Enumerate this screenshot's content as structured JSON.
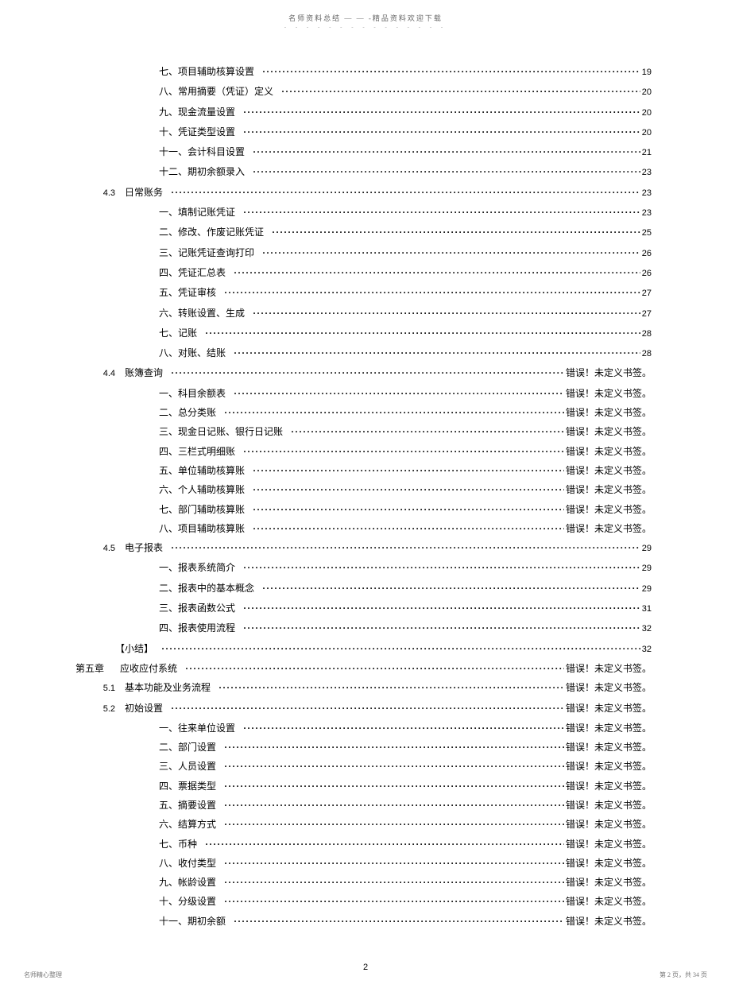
{
  "header": "名师资料总结 — — -精品资料欢迎下载",
  "header_sub": "- - - - - - - - - - - - - - -",
  "error_text": "错误！未定义书签。",
  "toc": [
    {
      "type": "sub",
      "title": "七、项目辅助核算设置",
      "page": "19"
    },
    {
      "type": "sub",
      "title": "八、常用摘要（凭证）定义",
      "page": "20"
    },
    {
      "type": "sub",
      "title": "九、现金流量设置",
      "page": "20"
    },
    {
      "type": "sub",
      "title": "十、凭证类型设置",
      "page": "20"
    },
    {
      "type": "sub",
      "title": "十一、会计科目设置",
      "page": "21"
    },
    {
      "type": "sub",
      "title": "十二、期初余额录入",
      "page": "23"
    },
    {
      "type": "sec",
      "num": "4.3",
      "title": "日常账务",
      "page": "23"
    },
    {
      "type": "sub",
      "title": "一、填制记账凭证",
      "page": "23"
    },
    {
      "type": "sub",
      "title": "二、修改、作废记账凭证",
      "page": "25"
    },
    {
      "type": "sub",
      "title": "三、记账凭证查询打印",
      "page": "26"
    },
    {
      "type": "sub",
      "title": "四、凭证汇总表",
      "page": "26"
    },
    {
      "type": "sub",
      "title": "五、凭证审核",
      "page": "27"
    },
    {
      "type": "sub",
      "title": "六、转账设置、生成",
      "page": "27"
    },
    {
      "type": "sub",
      "title": "七、记账",
      "page": "28"
    },
    {
      "type": "sub",
      "title": "八、对账、结账",
      "page": "28"
    },
    {
      "type": "sec",
      "num": "4.4",
      "title": "账簿查询",
      "page": "err"
    },
    {
      "type": "sub",
      "title": "一、科目余额表",
      "page": "err"
    },
    {
      "type": "sub",
      "title": "二、总分类账",
      "page": "err"
    },
    {
      "type": "sub",
      "title": "三、现金日记账、银行日记账",
      "page": "err"
    },
    {
      "type": "sub",
      "title": "四、三栏式明细账",
      "page": "err"
    },
    {
      "type": "sub",
      "title": "五、单位辅助核算账",
      "page": "err"
    },
    {
      "type": "sub",
      "title": "六、个人辅助核算账",
      "page": "err"
    },
    {
      "type": "sub",
      "title": "七、部门辅助核算账",
      "page": "err"
    },
    {
      "type": "sub",
      "title": "八、项目辅助核算账",
      "page": "err"
    },
    {
      "type": "sec",
      "num": "4.5",
      "title": "电子报表",
      "page": "29"
    },
    {
      "type": "sub",
      "title": "一、报表系统简介",
      "page": "29"
    },
    {
      "type": "sub",
      "title": "二、报表中的基本概念",
      "page": "29"
    },
    {
      "type": "sub",
      "title": "三、报表函数公式",
      "page": "31"
    },
    {
      "type": "sub",
      "title": "四、报表使用流程",
      "page": "32"
    },
    {
      "type": "summary",
      "title": "【小结】",
      "page": "32"
    },
    {
      "type": "chapter",
      "chapter": "第五章",
      "title": "应收应付系统",
      "page": "err"
    },
    {
      "type": "sec",
      "num": "5.1",
      "title": "基本功能及业务流程",
      "page": "err"
    },
    {
      "type": "sec",
      "num": "5.2",
      "title": "初始设置",
      "page": "err"
    },
    {
      "type": "sub",
      "title": "一、往来单位设置",
      "page": "err"
    },
    {
      "type": "sub",
      "title": "二、部门设置",
      "page": "err"
    },
    {
      "type": "sub",
      "title": "三、人员设置",
      "page": "err"
    },
    {
      "type": "sub",
      "title": "四、票据类型",
      "page": "err"
    },
    {
      "type": "sub",
      "title": "五、摘要设置",
      "page": "err"
    },
    {
      "type": "sub",
      "title": "六、结算方式",
      "page": "err"
    },
    {
      "type": "sub",
      "title": "七、币种",
      "page": "err"
    },
    {
      "type": "sub",
      "title": "八、收付类型",
      "page": "err"
    },
    {
      "type": "sub",
      "title": "九、帐龄设置",
      "page": "err"
    },
    {
      "type": "sub",
      "title": "十、分级设置",
      "page": "err"
    },
    {
      "type": "sub",
      "title": "十一、期初余额",
      "page": "err"
    }
  ],
  "page_num": "2",
  "footer_left": "名师精心整理",
  "footer_right": "第 2 页，共 34 页"
}
